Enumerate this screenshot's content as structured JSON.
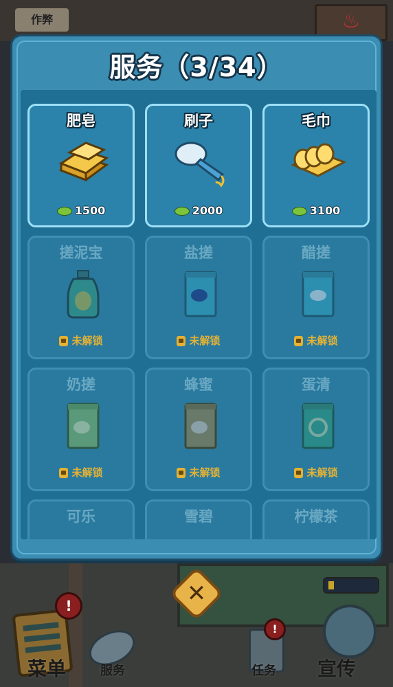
{
  "background": {
    "sign_text": "作弊",
    "steam_icon": "hot-spring-icon"
  },
  "modal": {
    "title": "服务（3/34）",
    "items": [
      {
        "name": "肥皂",
        "price": "1500",
        "unlocked": true,
        "icon": "soap-icon"
      },
      {
        "name": "刷子",
        "price": "2000",
        "unlocked": true,
        "icon": "brush-icon"
      },
      {
        "name": "毛巾",
        "price": "3100",
        "unlocked": true,
        "icon": "towel-icon"
      },
      {
        "name": "搓泥宝",
        "status": "未解锁",
        "unlocked": false,
        "icon": "bottle-icon"
      },
      {
        "name": "盐搓",
        "status": "未解锁",
        "unlocked": false,
        "icon": "salt-pack-icon"
      },
      {
        "name": "醋搓",
        "status": "未解锁",
        "unlocked": false,
        "icon": "vinegar-pack-icon"
      },
      {
        "name": "奶搓",
        "status": "未解锁",
        "unlocked": false,
        "icon": "milk-pack-icon"
      },
      {
        "name": "蜂蜜",
        "status": "未解锁",
        "unlocked": false,
        "icon": "honey-pack-icon"
      },
      {
        "name": "蛋清",
        "status": "未解锁",
        "unlocked": false,
        "icon": "egg-pack-icon"
      },
      {
        "name": "可乐",
        "unlocked": false,
        "icon": "cola-icon"
      },
      {
        "name": "雪碧",
        "unlocked": false,
        "icon": "sprite-icon"
      },
      {
        "name": "柠檬茶",
        "unlocked": false,
        "icon": "lemon-tea-icon"
      }
    ]
  },
  "close_icon": "close-icon",
  "toolbar": {
    "menu_label": "菜单",
    "service_label": "服务",
    "task_label": "任务",
    "promo_label": "宣传",
    "alert_mark": "!"
  },
  "colors": {
    "panel": "#3b8db2",
    "panel_border": "#1d4a66",
    "grid_bg": "#1f6e93",
    "card_unlocked_border": "#9fe0f7",
    "lock_text": "#e3b234",
    "coin": "#7bc43b"
  }
}
